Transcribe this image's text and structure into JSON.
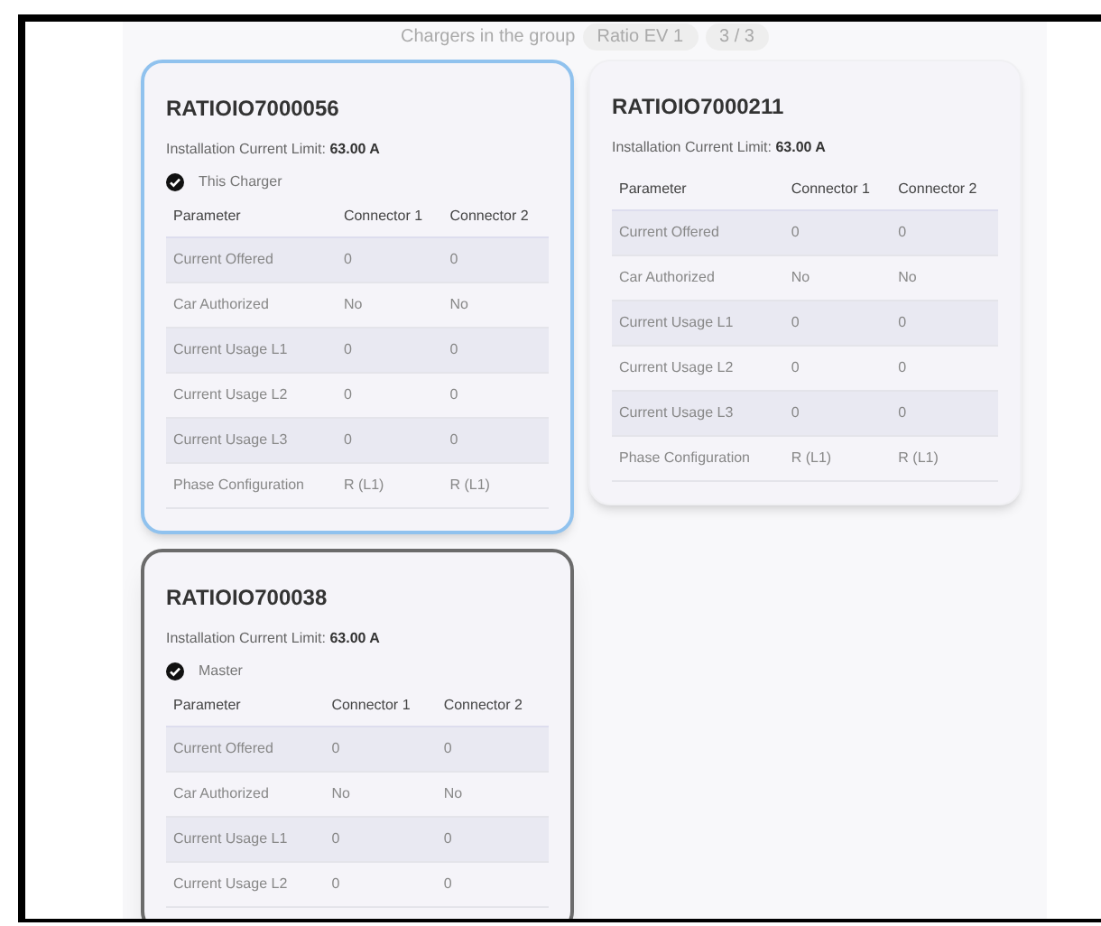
{
  "header": {
    "label": "Chargers in the group",
    "group": "Ratio EV 1",
    "count": "3 / 3"
  },
  "cards": [
    {
      "title": "RATIOIO7000056",
      "limit_label": "Installation Current Limit:",
      "limit_value": "63.00 A",
      "badge": "This Charger",
      "selected": true,
      "hovered": false,
      "columns": [
        "Parameter",
        "Connector 1",
        "Connector 2"
      ],
      "rows": [
        [
          "Current Offered",
          "0",
          "0"
        ],
        [
          "Car Authorized",
          "No",
          "No"
        ],
        [
          "Current Usage L1",
          "0",
          "0"
        ],
        [
          "Current Usage L2",
          "0",
          "0"
        ],
        [
          "Current Usage L3",
          "0",
          "0"
        ],
        [
          "Phase Configuration",
          "R (L1)",
          "R (L1)"
        ]
      ]
    },
    {
      "title": "RATIOIO7000211",
      "limit_label": "Installation Current Limit:",
      "limit_value": "63.00 A",
      "selected": false,
      "hovered": false,
      "columns": [
        "Parameter",
        "Connector 1",
        "Connector 2"
      ],
      "rows": [
        [
          "Current Offered",
          "0",
          "0"
        ],
        [
          "Car Authorized",
          "No",
          "No"
        ],
        [
          "Current Usage L1",
          "0",
          "0"
        ],
        [
          "Current Usage L2",
          "0",
          "0"
        ],
        [
          "Current Usage L3",
          "0",
          "0"
        ],
        [
          "Phase Configuration",
          "R (L1)",
          "R (L1)"
        ]
      ]
    },
    {
      "title": "RATIOIO700038",
      "limit_label": "Installation Current Limit:",
      "limit_value": "63.00 A",
      "badge": "Master",
      "selected": false,
      "hovered": true,
      "columns": [
        "Parameter",
        "Connector 1",
        "Connector 2"
      ],
      "rows": [
        [
          "Current Offered",
          "0",
          "0"
        ],
        [
          "Car Authorized",
          "No",
          "No"
        ],
        [
          "Current Usage L1",
          "0",
          "0"
        ],
        [
          "Current Usage L2",
          "0",
          "0"
        ]
      ]
    }
  ]
}
